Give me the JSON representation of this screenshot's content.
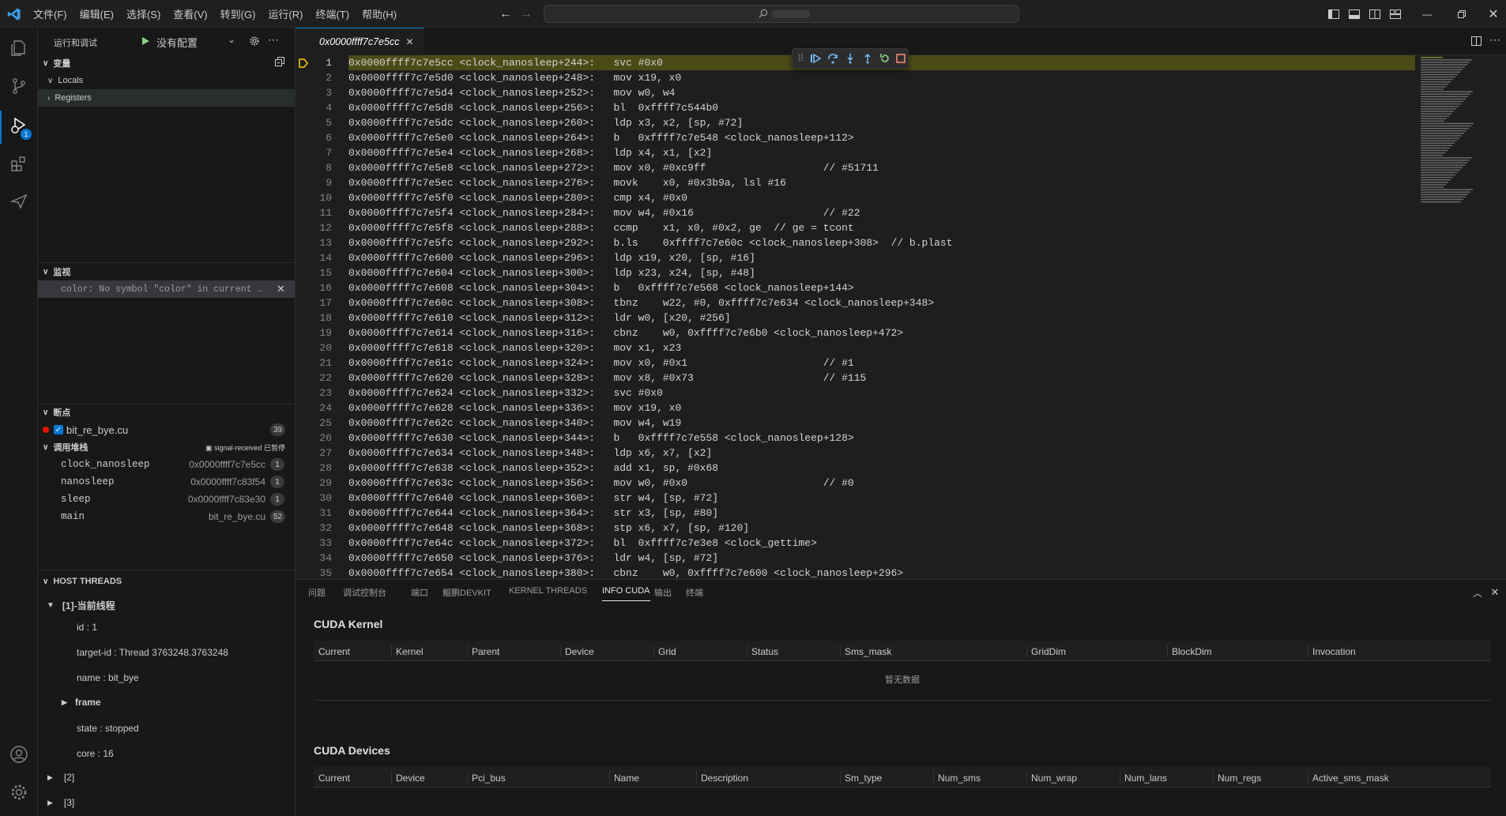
{
  "menu": [
    "文件(F)",
    "编辑(E)",
    "选择(S)",
    "查看(V)",
    "转到(G)",
    "运行(R)",
    "终端(T)",
    "帮助(H)"
  ],
  "sidebar": {
    "run_title": "运行和调试",
    "config": "没有配置",
    "vars_title": "变量",
    "locals": "Locals",
    "registers": "Registers",
    "watch_title": "监视",
    "watch_expr": "color: No symbol \"color\" in current …",
    "bp_title": "断点",
    "bp_file": "bit_re_bye.cu",
    "bp_line": "39",
    "cs_title": "调用堆栈",
    "cs_status": "signal-received 已暂停",
    "callstack": [
      {
        "name": "clock_nanosleep",
        "addr": "0x0000ffff7c7e5cc",
        "count": "1"
      },
      {
        "name": "nanosleep",
        "addr": "0x0000ffff7c83f54",
        "count": "1"
      },
      {
        "name": "sleep",
        "addr": "0x0000ffff7c83e30",
        "count": "1"
      },
      {
        "name": "main",
        "addr": "bit_re_bye.cu",
        "count": "52"
      }
    ],
    "host_title": "HOST THREADS",
    "thread": "[1]-当前线程",
    "props": [
      "id : 1",
      "target-id : Thread 3763248.3763248",
      "name : bit_bye"
    ],
    "frame": "frame",
    "props2": [
      "state : stopped",
      "core : 16"
    ],
    "t2": "[2]",
    "t3": "[3]",
    "debug_badge": "1"
  },
  "editor": {
    "tab": "0x0000ffff7c7e5cc",
    "lines": [
      "0x0000ffff7c7e5cc <clock_nanosleep+244>:   svc #0x0",
      "0x0000ffff7c7e5d0 <clock_nanosleep+248>:   mov x19, x0",
      "0x0000ffff7c7e5d4 <clock_nanosleep+252>:   mov w0, w4",
      "0x0000ffff7c7e5d8 <clock_nanosleep+256>:   bl  0xffff7c544b0",
      "0x0000ffff7c7e5dc <clock_nanosleep+260>:   ldp x3, x2, [sp, #72]",
      "0x0000ffff7c7e5e0 <clock_nanosleep+264>:   b   0xffff7c7e548 <clock_nanosleep+112>",
      "0x0000ffff7c7e5e4 <clock_nanosleep+268>:   ldp x4, x1, [x2]",
      "0x0000ffff7c7e5e8 <clock_nanosleep+272>:   mov x0, #0xc9ff                   // #51711",
      "0x0000ffff7c7e5ec <clock_nanosleep+276>:   movk    x0, #0x3b9a, lsl #16",
      "0x0000ffff7c7e5f0 <clock_nanosleep+280>:   cmp x4, #0x0",
      "0x0000ffff7c7e5f4 <clock_nanosleep+284>:   mov w4, #0x16                     // #22",
      "0x0000ffff7c7e5f8 <clock_nanosleep+288>:   ccmp    x1, x0, #0x2, ge  // ge = tcont",
      "0x0000ffff7c7e5fc <clock_nanosleep+292>:   b.ls    0xffff7c7e60c <clock_nanosleep+308>  // b.plast",
      "0x0000ffff7c7e600 <clock_nanosleep+296>:   ldp x19, x20, [sp, #16]",
      "0x0000ffff7c7e604 <clock_nanosleep+300>:   ldp x23, x24, [sp, #48]",
      "0x0000ffff7c7e608 <clock_nanosleep+304>:   b   0xffff7c7e568 <clock_nanosleep+144>",
      "0x0000ffff7c7e60c <clock_nanosleep+308>:   tbnz    w22, #0, 0xffff7c7e634 <clock_nanosleep+348>",
      "0x0000ffff7c7e610 <clock_nanosleep+312>:   ldr w0, [x20, #256]",
      "0x0000ffff7c7e614 <clock_nanosleep+316>:   cbnz    w0, 0xffff7c7e6b0 <clock_nanosleep+472>",
      "0x0000ffff7c7e618 <clock_nanosleep+320>:   mov x1, x23",
      "0x0000ffff7c7e61c <clock_nanosleep+324>:   mov x0, #0x1                      // #1",
      "0x0000ffff7c7e620 <clock_nanosleep+328>:   mov x8, #0x73                     // #115",
      "0x0000ffff7c7e624 <clock_nanosleep+332>:   svc #0x0",
      "0x0000ffff7c7e628 <clock_nanosleep+336>:   mov x19, x0",
      "0x0000ffff7c7e62c <clock_nanosleep+340>:   mov w4, w19",
      "0x0000ffff7c7e630 <clock_nanosleep+344>:   b   0xffff7c7e558 <clock_nanosleep+128>",
      "0x0000ffff7c7e634 <clock_nanosleep+348>:   ldp x6, x7, [x2]",
      "0x0000ffff7c7e638 <clock_nanosleep+352>:   add x1, sp, #0x68",
      "0x0000ffff7c7e63c <clock_nanosleep+356>:   mov w0, #0x0                      // #0",
      "0x0000ffff7c7e640 <clock_nanosleep+360>:   str w4, [sp, #72]",
      "0x0000ffff7c7e644 <clock_nanosleep+364>:   str x3, [sp, #80]",
      "0x0000ffff7c7e648 <clock_nanosleep+368>:   stp x6, x7, [sp, #120]",
      "0x0000ffff7c7e64c <clock_nanosleep+372>:   bl  0xffff7c7e3e8 <clock_gettime>",
      "0x0000ffff7c7e650 <clock_nanosleep+376>:   ldr w4, [sp, #72]",
      "0x0000ffff7c7e654 <clock_nanosleep+380>:   cbnz    w0, 0xffff7c7e600 <clock_nanosleep+296>"
    ]
  },
  "panel": {
    "tabs": [
      "问题",
      "调试控制台",
      "端口",
      "鲲鹏DEVKIT",
      "KERNEL THREADS",
      "INFO CUDA",
      "输出",
      "终端"
    ],
    "active": "INFO CUDA",
    "kernel_title": "CUDA Kernel",
    "kernel_cols": [
      "Current",
      "Kernel",
      "Parent",
      "Device",
      "Grid",
      "Status",
      "Sms_mask",
      "GridDim",
      "BlockDim",
      "Invocation"
    ],
    "empty": "暂无数据",
    "devices_title": "CUDA Devices",
    "device_cols": [
      "Current",
      "Device",
      "Pci_bus",
      "Name",
      "Description",
      "Sm_type",
      "Num_sms",
      "Num_wrap",
      "Num_lans",
      "Num_regs",
      "Active_sms_mask"
    ]
  }
}
